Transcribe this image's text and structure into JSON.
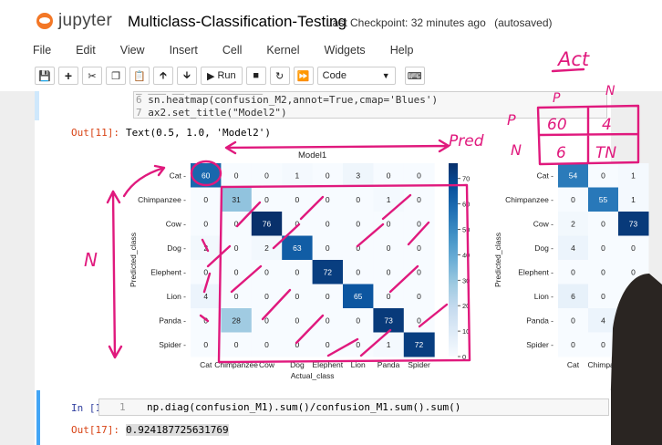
{
  "header": {
    "logo_text": "jupyter",
    "notebook_title": "Multiclass-Classification-Testing",
    "checkpoint": "Last Checkpoint: 32 minutes ago",
    "saved_status": "(autosaved)"
  },
  "menu": [
    "File",
    "Edit",
    "View",
    "Insert",
    "Cell",
    "Kernel",
    "Widgets",
    "Help"
  ],
  "toolbar": {
    "run_label": "Run",
    "cell_type": "Code"
  },
  "code_cell": {
    "lines": [
      {
        "no": "6",
        "text": "sn.heatmap(confusion_M2,annot=True,cmap='Blues')"
      },
      {
        "no": "7",
        "text": "ax2.set_title(\"Model2\")"
      }
    ]
  },
  "out11": {
    "prompt": "Out[11]:",
    "text": "Text(0.5, 1.0, 'Model2')"
  },
  "chart_data": [
    {
      "type": "heatmap",
      "title": "Model1",
      "xlabel": "Actual_class",
      "ylabel": "Predicted_class",
      "categories_x": [
        "Cat",
        "Chimpanzee",
        "Cow",
        "Dog",
        "Elephent",
        "Lion",
        "Panda",
        "Spider"
      ],
      "categories_y": [
        "Cat",
        "Chimpanzee",
        "Cow",
        "Dog",
        "Elephent",
        "Lion",
        "Panda",
        "Spider"
      ],
      "values": [
        [
          60,
          0,
          0,
          1,
          0,
          3,
          0,
          0
        ],
        [
          0,
          31,
          0,
          0,
          0,
          0,
          1,
          0
        ],
        [
          0,
          0,
          76,
          0,
          0,
          0,
          0,
          0
        ],
        [
          2,
          0,
          2,
          63,
          0,
          0,
          0,
          0
        ],
        [
          0,
          0,
          0,
          0,
          72,
          0,
          0,
          0
        ],
        [
          4,
          0,
          0,
          0,
          0,
          65,
          0,
          0
        ],
        [
          0,
          28,
          0,
          0,
          0,
          0,
          73,
          0
        ],
        [
          0,
          0,
          0,
          0,
          0,
          0,
          1,
          72
        ]
      ],
      "colorbar_ticks": [
        0,
        10,
        20,
        30,
        40,
        50,
        60,
        70
      ],
      "vmin": 0,
      "vmax": 76,
      "cmap": "Blues"
    },
    {
      "type": "heatmap",
      "title": "",
      "xlabel": "",
      "ylabel": "Predicted_class",
      "categories_x": [
        "Cat",
        "Chimpan"
      ],
      "categories_y": [
        "Cat",
        "Chimpanzee",
        "Cow",
        "Dog",
        "Elephent",
        "Lion",
        "Panda",
        "Spider"
      ],
      "values": [
        [
          54,
          0,
          1
        ],
        [
          0,
          55,
          1
        ],
        [
          2,
          0,
          73
        ],
        [
          4,
          0,
          0
        ],
        [
          0,
          0,
          0
        ],
        [
          6,
          0,
          0
        ],
        [
          0,
          4,
          0
        ],
        [
          0,
          0,
          0
        ]
      ],
      "vmin": 0,
      "vmax": 76,
      "cmap": "Blues"
    }
  ],
  "annotations": {
    "act": "Act",
    "p_col": "P",
    "n_col": "N",
    "p_row": "P",
    "n_row": "N",
    "tp": "60",
    "fn": "4",
    "fp": "6",
    "tn": "TN",
    "pred": "Pred",
    "n_left": "N"
  },
  "in17": {
    "prompt": "In [17]:",
    "line_no": "1",
    "code": "np.diag(confusion_M1).sum()/confusion_M1.sum().sum()"
  },
  "out17": {
    "prompt": "Out[17]:",
    "value": "0.924187725631769"
  },
  "colors": {
    "accent": "#f37726",
    "ink": "#e0197d"
  }
}
